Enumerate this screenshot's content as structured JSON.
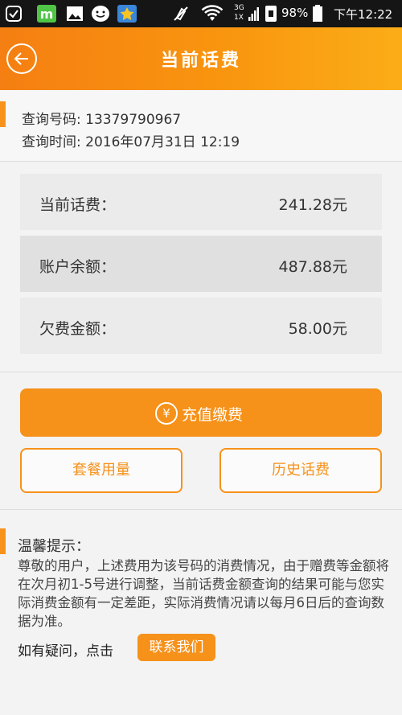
{
  "status_bar": {
    "network": "3G\n1X",
    "battery_percent": "98%",
    "time": "下午12:22"
  },
  "header": {
    "title": "当前话费"
  },
  "info": {
    "number_label": "查询号码",
    "number": "13379790967",
    "time_label": "查询时间",
    "time": "2016年07月31日 12:19"
  },
  "balances": [
    {
      "label": "当前话费：",
      "value": "241.28元"
    },
    {
      "label": "账户余额：",
      "value": "487.88元"
    },
    {
      "label": "欠费金额：",
      "value": "58.00元"
    }
  ],
  "actions": {
    "recharge_icon": "¥",
    "recharge_label": "充值缴费",
    "package_label": "套餐用量",
    "history_label": "历史话费"
  },
  "tips": {
    "title": "温馨提示：",
    "body": "尊敬的用户，上述费用为该号码的消费情况，由于赠费等金额将在次月初1-5号进行调整，当前话费金额查询的结果可能与您实际消费金额有一定差距，实际消费情况请以每月6日后的查询数据为准。",
    "contact_prefix": "如有疑问，点击",
    "contact_button": "联系我们"
  },
  "colors": {
    "accent": "#f6911a",
    "header_start": "#f57f12",
    "header_end": "#fbad17"
  }
}
